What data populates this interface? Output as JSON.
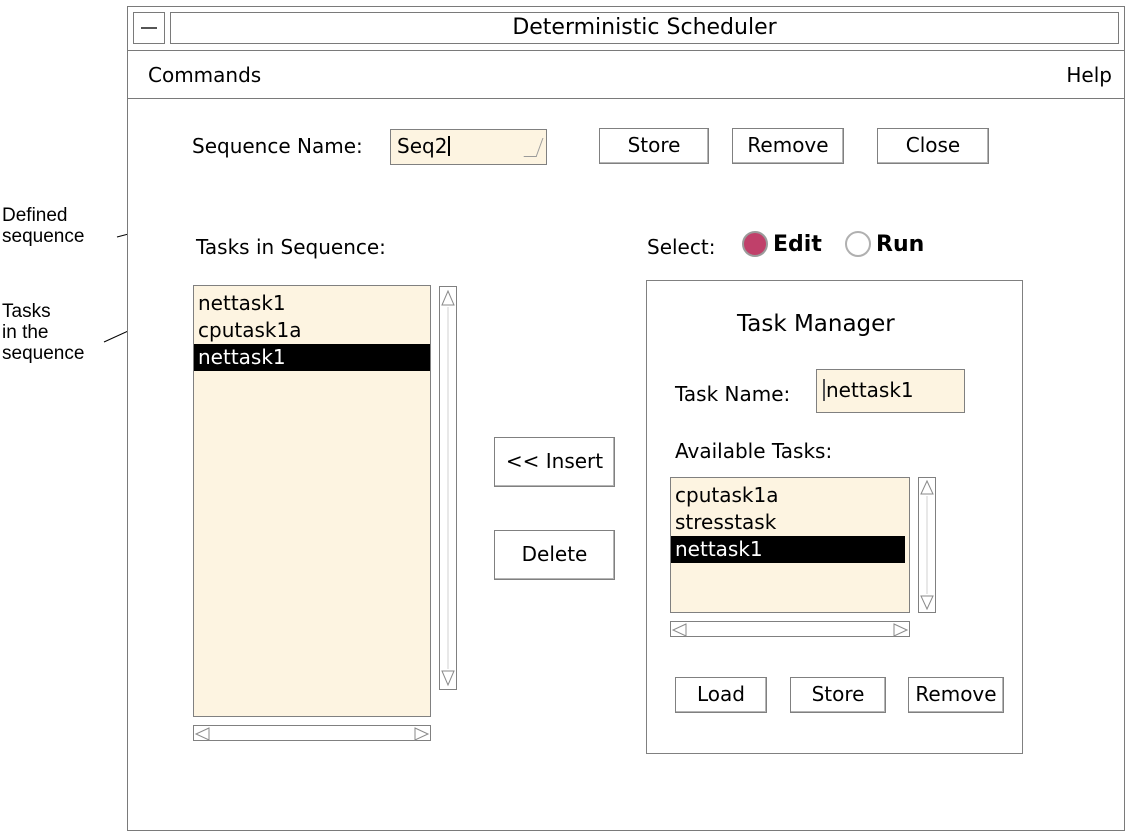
{
  "annotations": {
    "defined_sequence": [
      "Defined",
      "sequence"
    ],
    "tasks_in_sequence": [
      "Tasks",
      "in the",
      "sequence"
    ]
  },
  "window": {
    "title": "Deterministic Scheduler"
  },
  "menubar": {
    "commands": "Commands",
    "help": "Help"
  },
  "sequence": {
    "label": "Sequence Name:",
    "value": "Seq2",
    "store": "Store",
    "remove": "Remove",
    "close": "Close"
  },
  "tasks_in_sequence": {
    "label": "Tasks in Sequence:",
    "items": [
      "nettask1",
      "cputask1a",
      "nettask1"
    ],
    "selected_index": 2
  },
  "middle": {
    "insert": "<< Insert",
    "delete": "Delete"
  },
  "select": {
    "label": "Select:",
    "edit": "Edit",
    "run": "Run",
    "selected": "Edit",
    "accent": "#c0406a"
  },
  "task_manager": {
    "title": "Task Manager",
    "task_name_label": "Task Name:",
    "task_name_value": "nettask1",
    "available_label": "Available Tasks:",
    "available": [
      "cputask1a",
      "stresstask",
      "nettask1"
    ],
    "selected_index": 2,
    "load": "Load",
    "store": "Store",
    "remove": "Remove"
  }
}
